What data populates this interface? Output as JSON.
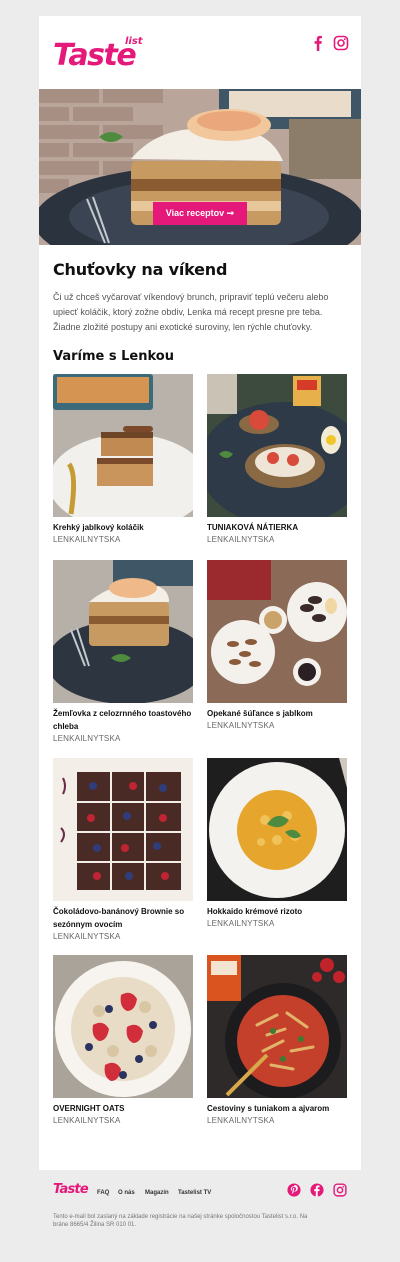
{
  "brand": {
    "name": "Taste",
    "sub": "list",
    "color": "#e4197a"
  },
  "header": {
    "icons": [
      "facebook-icon",
      "instagram-icon"
    ]
  },
  "hero": {
    "button_label": "Viac receptov ➞"
  },
  "main": {
    "title": "Chuťovky na víkend",
    "intro": "Či už chceš vyčarovať víkendový brunch, pripraviť teplú večeru alebo upiecť koláčik, ktorý zožne obdiv, Lenka má recept presne pre teba. Žiadne zložité postupy ani exotické suroviny, len rýchle chuťovky.",
    "subtitle": "Varíme s Lenkou"
  },
  "recipes": [
    {
      "name": "Krehký jablkový koláčik",
      "author": "LENKAILNYTSKA"
    },
    {
      "name": "TUNIAKOVÁ NÁTIERKA",
      "author": "LENKAILNYTSKA"
    },
    {
      "name": "Žemľovka z celozrnného toastového chleba",
      "author": "LENKAILNYTSKA"
    },
    {
      "name": "Opekané šúľance s jablkom",
      "author": "LENKAILNYTSKA"
    },
    {
      "name": "Čokoládovo-banánový Brownie so sezónnym ovocím",
      "author": "LENKAILNYTSKA"
    },
    {
      "name": "Hokkaido krémové rizoto",
      "author": "LENKAILNYTSKA"
    },
    {
      "name": "OVERNIGHT OATS",
      "author": "LENKAILNYTSKA"
    },
    {
      "name": "Cestoviny s tuniakom a ajvarom",
      "author": "LENKAILNYTSKA"
    }
  ],
  "footer": {
    "logo": "Taste",
    "links": [
      "FAQ",
      "O nás",
      "Magazín",
      "Tastelist TV"
    ],
    "icons": [
      "pinterest-icon",
      "facebook-icon",
      "instagram-icon"
    ],
    "note": "Tento e-mail bol zaslaný na základe registrácie na našej stránke spoločnostou Tastelist s.r.o. Na bráne 8665/4 Žilina SR 010 01."
  }
}
